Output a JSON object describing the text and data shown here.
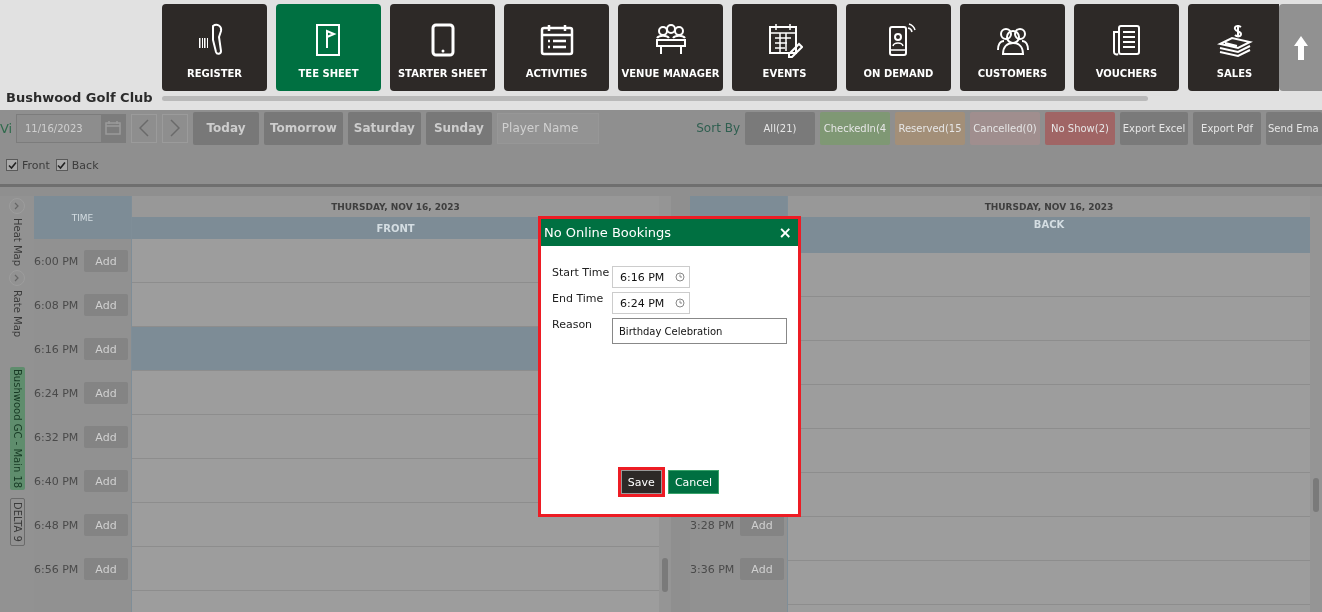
{
  "nav": {
    "tiles": [
      {
        "label": "REGISTER",
        "selected": false
      },
      {
        "label": "TEE SHEET",
        "selected": true
      },
      {
        "label": "STARTER SHEET",
        "selected": false
      },
      {
        "label": "ACTIVITIES",
        "selected": false
      },
      {
        "label": "VENUE MANAGER",
        "selected": false
      },
      {
        "label": "EVENTS",
        "selected": false
      },
      {
        "label": "ON DEMAND",
        "selected": false
      },
      {
        "label": "CUSTOMERS",
        "selected": false
      },
      {
        "label": "VOUCHERS",
        "selected": false
      },
      {
        "label": "SALES",
        "selected": false
      }
    ],
    "club_name": "Bushwood Golf Club"
  },
  "toolbar": {
    "view_label": "Vi",
    "date": "11/16/2023",
    "quick_days": [
      "Today",
      "Tomorrow",
      "Saturday",
      "Sunday"
    ],
    "player_placeholder": "Player Name",
    "sort_label": "Sort By",
    "sort_buttons": [
      {
        "label": "All(21)",
        "color": "#7a7a7a"
      },
      {
        "label": "CheckedIn(4",
        "color": "#7f9874"
      },
      {
        "label": "Reserved(15",
        "color": "#a38f78"
      },
      {
        "label": "Cancelled(0)",
        "color": "#a08e8e"
      },
      {
        "label": "No Show(2)",
        "color": "#a06565"
      }
    ],
    "actions": [
      "Export Excel",
      "Export Pdf",
      "Send Ema"
    ],
    "courses": [
      {
        "label": "Front",
        "checked": true
      },
      {
        "label": "Back",
        "checked": true
      }
    ]
  },
  "side_tabs": [
    {
      "label": "Heat Map",
      "kind": "toggle"
    },
    {
      "label": "Rate Map",
      "kind": "toggle"
    },
    {
      "label": "Bushwood GC - Main 18",
      "kind": "course"
    },
    {
      "label": "DELTA 9",
      "kind": "outline"
    }
  ],
  "front": {
    "time_header": "TIME",
    "date": "THURSDAY, NOV 16, 2023",
    "course": "FRONT",
    "rows": [
      {
        "time": "6:00 PM",
        "add": "Add",
        "selected": false
      },
      {
        "time": "6:08 PM",
        "add": "Add",
        "selected": false
      },
      {
        "time": "6:16 PM",
        "add": "Add",
        "selected": true
      },
      {
        "time": "6:24 PM",
        "add": "Add",
        "selected": false
      },
      {
        "time": "6:32 PM",
        "add": "Add",
        "selected": false
      },
      {
        "time": "6:40 PM",
        "add": "Add",
        "selected": false
      },
      {
        "time": "6:48 PM",
        "add": "Add",
        "selected": false
      },
      {
        "time": "6:56 PM",
        "add": "Add",
        "selected": false
      }
    ]
  },
  "back": {
    "date": "THURSDAY, NOV 16, 2023",
    "course": "BACK",
    "rows": [
      {
        "time": "3:28 PM",
        "add": "Add"
      },
      {
        "time": "3:36 PM",
        "add": "Add"
      }
    ]
  },
  "dialog": {
    "title": "No Online Bookings",
    "close": "×",
    "fields": [
      {
        "label": "Start Time",
        "value": "6:16 PM",
        "kind": "time"
      },
      {
        "label": "End Time",
        "value": "6:24 PM",
        "kind": "time"
      },
      {
        "label": "Reason",
        "value": "Birthday Celebration",
        "kind": "text"
      }
    ],
    "buttons": [
      {
        "label": "Save",
        "kind": "primary",
        "focused": true
      },
      {
        "label": "Cancel",
        "kind": "secondary",
        "focused": false
      }
    ]
  }
}
